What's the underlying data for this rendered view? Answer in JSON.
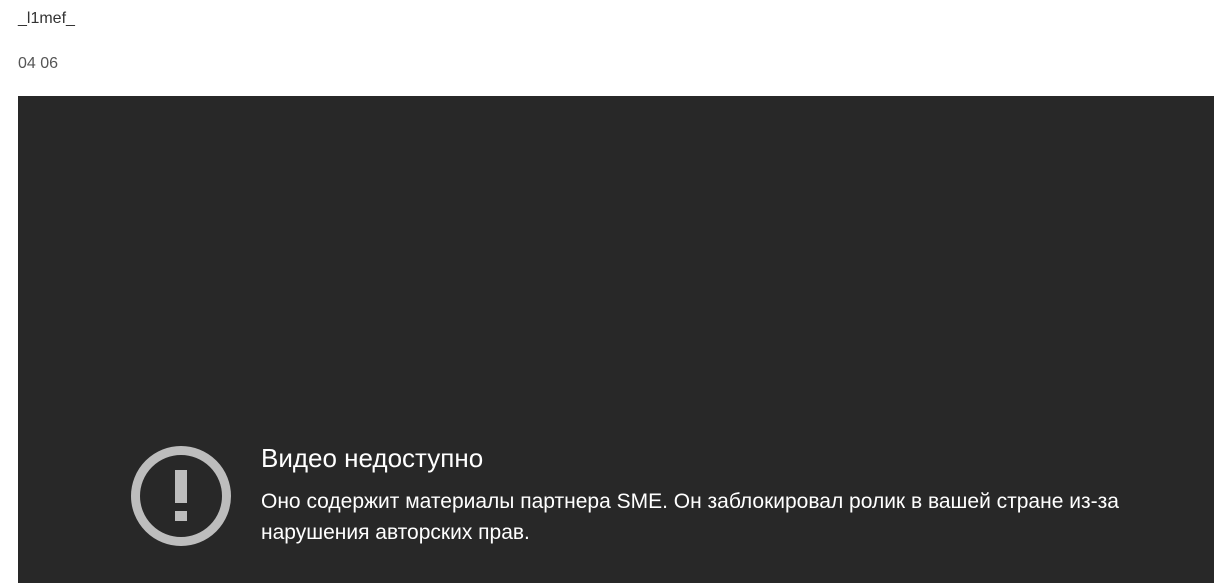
{
  "post": {
    "title": "_l1mef_",
    "date": "04 06"
  },
  "player": {
    "icon": "exclamation-circle-icon",
    "heading": "Видео недоступно",
    "message": "Оно содержит материалы партнера SME. Он заблокировал ролик в вашей стране из-за нарушения авторских прав."
  },
  "colors": {
    "player_background": "#282828",
    "icon": "#bdbdbd",
    "heading_text": "#ffffff",
    "page_background": "#ffffff"
  }
}
